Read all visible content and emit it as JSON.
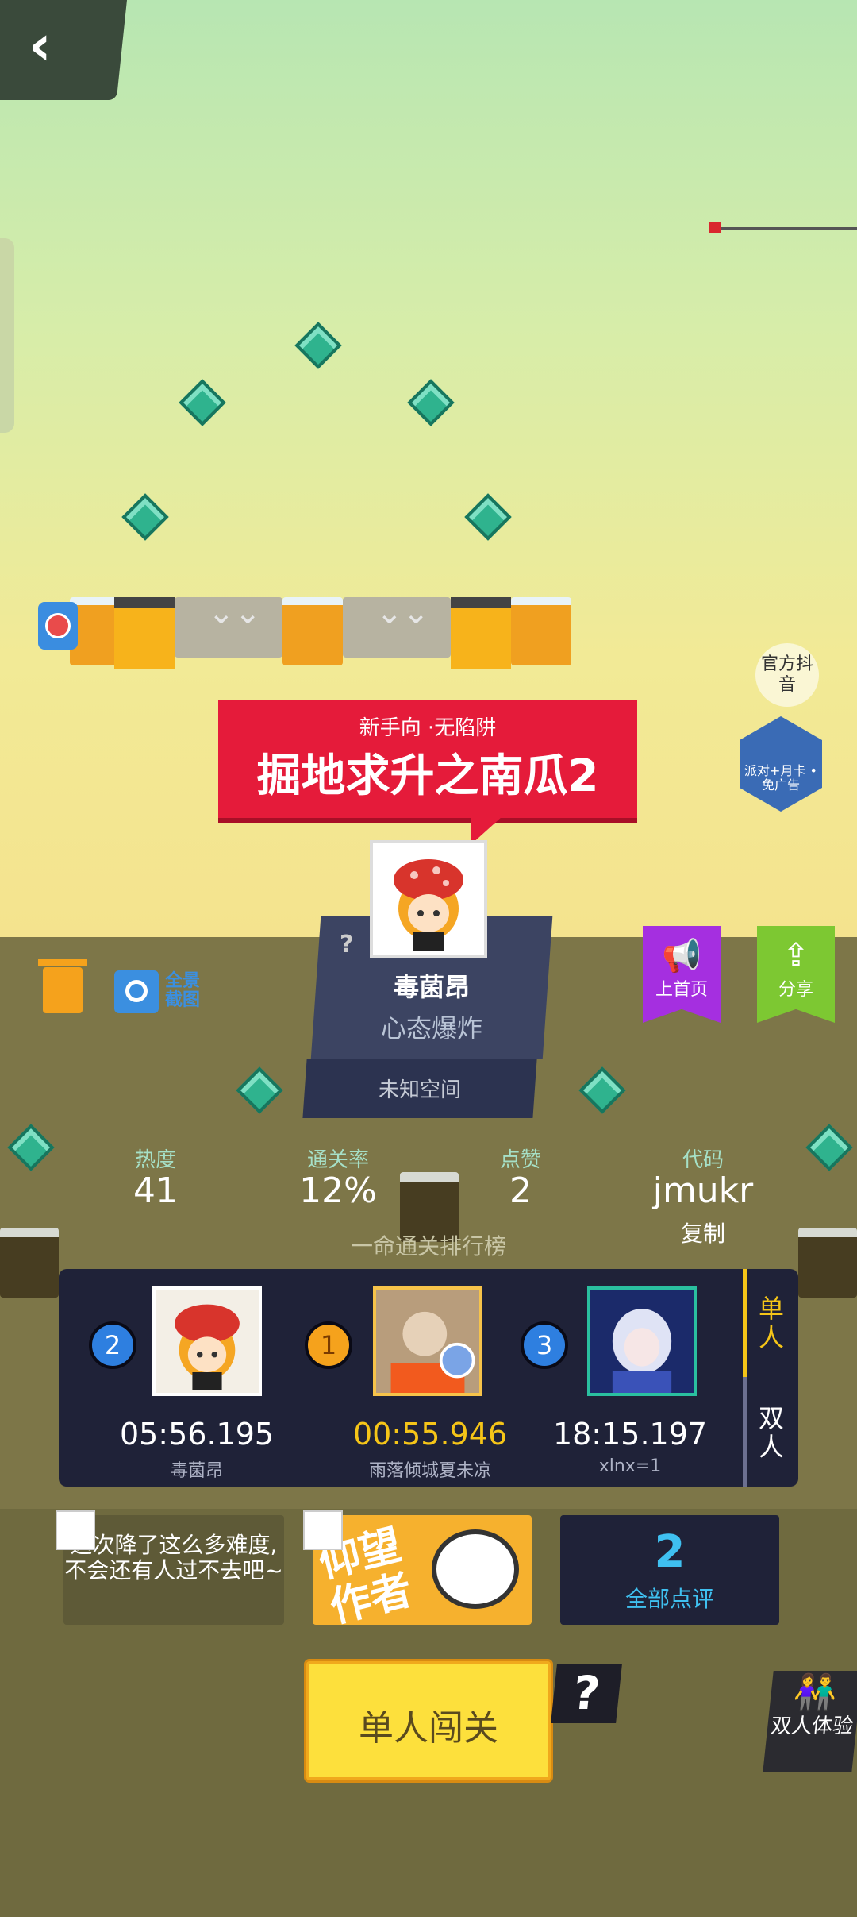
{
  "level": {
    "subtitle": "新手向 ·无陷阱",
    "title": "掘地求升之南瓜2"
  },
  "top": {
    "official_douyin": "官方抖音",
    "ad_badge": "派对+月卡 •免广告"
  },
  "author_card": {
    "question": "?",
    "name": "毒菌昂",
    "mood": "心态爆炸",
    "space": "未知空间"
  },
  "tools": {
    "screenshot_label_1": "全景",
    "screenshot_label_2": "截图"
  },
  "actions": {
    "promote": "上首页",
    "share": "分享"
  },
  "stats": [
    {
      "label": "热度",
      "value": "41"
    },
    {
      "label": "通关率",
      "value": "12%"
    },
    {
      "label": "点赞",
      "value": "2"
    },
    {
      "label": "代码",
      "value": "jmukr"
    }
  ],
  "copy_label": "复制",
  "leaderboard": {
    "title": "一命通关排行榜",
    "tab_single": "单人",
    "tab_double": "双人",
    "entries": [
      {
        "rank": "2",
        "time": "05:56.195",
        "name": "毒菌昂"
      },
      {
        "rank": "1",
        "time": "00:55.946",
        "name": "雨落倾城夏未凉"
      },
      {
        "rank": "3",
        "time": "18:15.197",
        "name": "xlnx=1"
      }
    ]
  },
  "comment": "这次降了这么多难度,不会还有人过不去吧~",
  "look_up": "仰望作者",
  "reviews": {
    "count": "2",
    "label": "全部点评"
  },
  "play_button": "单人闯关",
  "help": "?",
  "duo_button": "双人体验",
  "colors": {
    "banner": "#e51b3a",
    "promote": "#a52fe0",
    "share": "#7dc832",
    "gold_time": "#f5c518",
    "play": "#fde03c"
  }
}
